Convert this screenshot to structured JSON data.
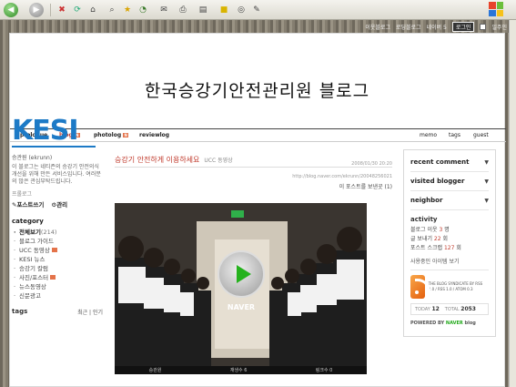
{
  "browser": {
    "buttons": [
      "back-icon",
      "forward-icon",
      "stop-icon",
      "refresh-icon",
      "home-icon",
      "search-icon",
      "favorites-icon",
      "history-icon",
      "mail-icon",
      "print-icon",
      "edit-icon",
      "discuss-icon",
      "messenger-icon",
      "research-icon"
    ]
  },
  "topnav": {
    "links": [
      "이웃블로그",
      "로딩블로그",
      "네이버 5"
    ],
    "login_label": "로그인",
    "checkbox_label": "일주인"
  },
  "blog": {
    "title": "한국승강기안전관리원 블로그"
  },
  "menu": {
    "left": [
      {
        "label": "prologue",
        "badge": ""
      },
      {
        "label": "blog",
        "badge": "N"
      },
      {
        "label": "photolog",
        "badge": "N"
      },
      {
        "label": "reviewlog",
        "badge": ""
      }
    ],
    "right": [
      "memo",
      "tags",
      "guest"
    ]
  },
  "profile": {
    "logo": "KESI",
    "nickname": "승관원 (ekrunn)",
    "intro": "이 블로그는 네티즌의 승강기 안전의식 개선을 위해 만든 서비스입니다. 여러분의 많은 관심부탁드립니다.",
    "prologue_link": "프롤로그",
    "post_write": "포스트쓰기",
    "manage": "관리"
  },
  "category": {
    "title": "category",
    "items": [
      {
        "label": "전체보기",
        "count": "(214)",
        "top": true
      },
      {
        "label": "블로그 가이드",
        "count": "",
        "top": false
      },
      {
        "label": "UCC 동영상",
        "count": "",
        "top": false
      },
      {
        "label": "KESI 뉴스",
        "count": "",
        "top": false
      },
      {
        "label": "승강기 칼럼",
        "count": "",
        "top": false
      },
      {
        "label": "사진/포스터",
        "count": "",
        "top": false
      },
      {
        "label": "뉴스동영상",
        "count": "",
        "top": false
      },
      {
        "label": "신문광고",
        "count": "",
        "top": false
      }
    ]
  },
  "tags": {
    "title": "tags",
    "right": "최근 | 인기"
  },
  "post": {
    "title": "승강기 안전하게 이용하세요",
    "category": "UCC 동영상",
    "date": "2008/01/30 20:20",
    "url": "http://blog.naver.com/ekrunn/20048256021",
    "meta": "이 포스트를 보낸곳 (1)",
    "video": {
      "brand": "NAVER",
      "bar": [
        "승관원",
        "재생수 6",
        "링크수 0"
      ]
    }
  },
  "rightbar": {
    "rows": [
      "recent comment",
      "visited blogger",
      "neighbor"
    ],
    "activity_title": "activity",
    "activity": [
      {
        "label": "블로그 이웃",
        "n": "3",
        "unit": "명"
      },
      {
        "label": "글 보내기",
        "n": "22",
        "unit": "회"
      },
      {
        "label": "포스트 스크랩",
        "n": "127",
        "unit": "회"
      }
    ],
    "follow": "사용중인 아이템 보기",
    "rss_text": "THE BLOG SYNDICATE BY RSS 2.0 / RSS 1.0 / ATOM 0.3",
    "today_label": "TODAY",
    "today": "12",
    "total_label": "TOTAL",
    "total": "2053",
    "powered": "POWERED BY",
    "powered_brand": "NAVER",
    "powered_suffix": "blog"
  }
}
